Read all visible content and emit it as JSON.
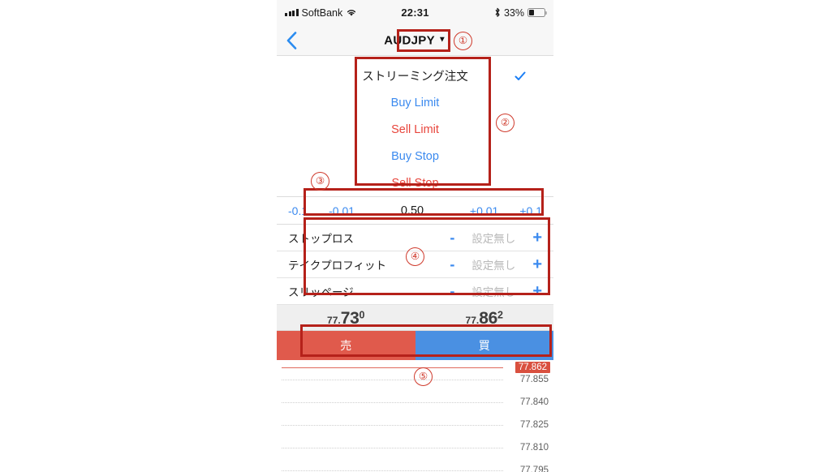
{
  "status_bar": {
    "carrier": "SoftBank",
    "time": "22:31",
    "battery_percent": "33%",
    "signal_icon": "signal-bars-icon",
    "wifi_icon": "wifi-icon",
    "bluetooth_icon": "bluetooth-icon",
    "battery_icon": "battery-icon"
  },
  "navbar": {
    "back_icon": "back-chevron-icon",
    "pair": "AUDJPY",
    "caret": "▼"
  },
  "order_types": [
    {
      "label": "ストリーミング注文",
      "kind": "streaming",
      "selected": true
    },
    {
      "label": "Buy Limit",
      "kind": "buy",
      "selected": false
    },
    {
      "label": "Sell Limit",
      "kind": "sell",
      "selected": false
    },
    {
      "label": "Buy Stop",
      "kind": "buy",
      "selected": false
    },
    {
      "label": "Sell Stop",
      "kind": "sell",
      "selected": false
    }
  ],
  "volume": {
    "minus_large": "-0.1",
    "minus_small": "-0.01",
    "value": "0.50",
    "plus_small": "+0.01",
    "plus_large": "+0.1"
  },
  "params": [
    {
      "name": "ストップロス",
      "minus": "-",
      "value": "設定無し",
      "plus": "+"
    },
    {
      "name": "テイクプロフィット",
      "minus": "-",
      "value": "設定無し",
      "plus": "+"
    },
    {
      "name": "スリッページ",
      "minus": "-",
      "value": "設定無し",
      "plus": "+"
    }
  ],
  "prices": {
    "bid": {
      "prefix": "77.",
      "main": "73",
      "sup": "0"
    },
    "ask": {
      "prefix": "77.",
      "main": "86",
      "sup": "2"
    }
  },
  "trade_buttons": {
    "sell": "売",
    "buy": "買"
  },
  "chart": {
    "ask_line_label": "77.862",
    "gridlines": [
      "77.855",
      "77.840",
      "77.825",
      "77.810",
      "77.795"
    ]
  },
  "annotations": {
    "n1": "①",
    "n2": "②",
    "n3": "③",
    "n4": "④",
    "n5": "⑤"
  },
  "colors": {
    "blue": "#3b8aef",
    "red": "#e8453c",
    "sell_button": "#e05a4c",
    "buy_button": "#4a90e2",
    "annotation": "#b5211a"
  }
}
